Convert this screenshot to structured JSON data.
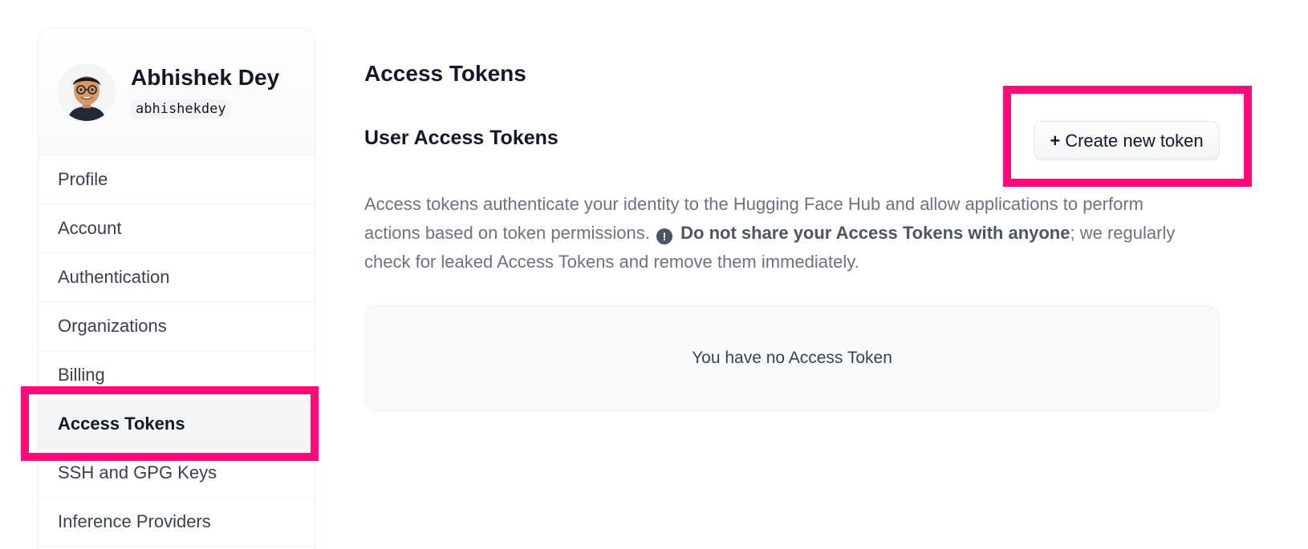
{
  "user": {
    "name": "Abhishek Dey",
    "handle": "abhishekdey"
  },
  "sidebar": {
    "items": [
      {
        "label": "Profile",
        "active": false
      },
      {
        "label": "Account",
        "active": false
      },
      {
        "label": "Authentication",
        "active": false
      },
      {
        "label": "Organizations",
        "active": false
      },
      {
        "label": "Billing",
        "active": false
      },
      {
        "label": "Access Tokens",
        "active": true
      },
      {
        "label": "SSH and GPG Keys",
        "active": false
      },
      {
        "label": "Inference Providers",
        "active": false
      }
    ]
  },
  "main": {
    "title": "Access Tokens",
    "section_title": "User Access Tokens",
    "create_button": {
      "icon": "+",
      "label": "Create new token"
    },
    "description": {
      "part1": "Access tokens authenticate your identity to the Hugging Face Hub and allow applications to perform actions based on token permissions.",
      "warn_icon": "!",
      "bold1": "Do not share your ",
      "bold2": "Access Tokens",
      "bold3": " with anyone",
      "part2": "; we regularly check for leaked Access Tokens and remove them immediately."
    },
    "empty_message": "You have no Access Token"
  },
  "colors": {
    "highlight": "#ff0a78",
    "active_bg": "#f3f4f6",
    "muted_text": "#6b7280"
  }
}
